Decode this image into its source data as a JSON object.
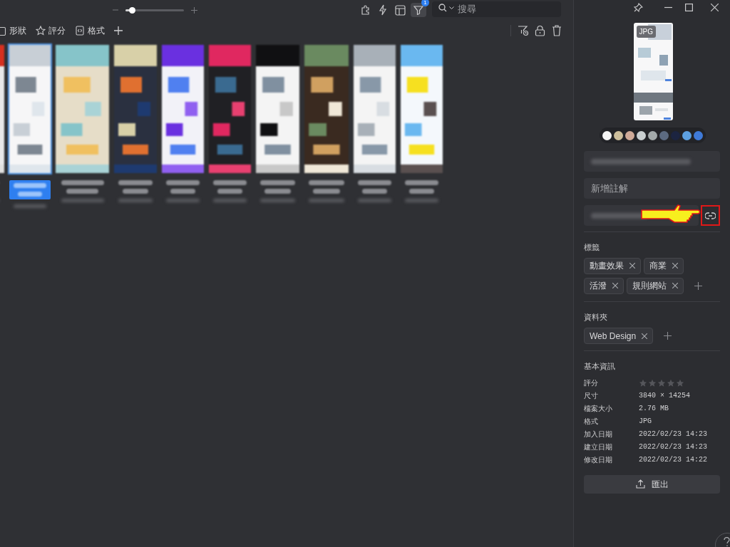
{
  "toolbar": {
    "zoom": {
      "level": 0.12
    },
    "filter_badge": "1",
    "search": {
      "placeholder": "搜尋"
    }
  },
  "filters": [
    "形狀",
    "評分",
    "格式"
  ],
  "thumbnails": [
    {
      "kind": "picture",
      "selected": false
    },
    {
      "kind": "picture",
      "selected": true
    },
    {
      "kind": "picture",
      "selected": false
    },
    {
      "kind": "picture",
      "selected": false
    },
    {
      "kind": "picture",
      "selected": false
    },
    {
      "kind": "picture",
      "selected": false
    },
    {
      "kind": "picture",
      "selected": false
    },
    {
      "kind": "picture",
      "selected": false
    },
    {
      "kind": "picture",
      "selected": false
    },
    {
      "kind": "picture",
      "selected": false
    }
  ],
  "inspector": {
    "preview": {
      "badge": "JPG"
    },
    "palette": [
      {
        "color": "#f4f4f4"
      },
      {
        "color": "#cdbf9c"
      },
      {
        "color": "#cfaa98"
      },
      {
        "color": "#c9cfd0"
      },
      {
        "color": "#a3a9aa"
      },
      {
        "color": "#5c6a80"
      },
      {
        "color": "#1c2440"
      },
      {
        "color": "#5da0e0"
      },
      {
        "color": "#3f7ad8"
      }
    ],
    "note": {
      "placeholder": "新增註解"
    },
    "tags": {
      "title": "標籤",
      "items": [
        "動畫效果",
        "商業",
        "活潑",
        "規則網站"
      ]
    },
    "folders": {
      "title": "資料夾",
      "items": [
        "Web Design"
      ]
    },
    "info": {
      "title": "基本資訊",
      "rating": {
        "label": "評分",
        "stars": 0
      },
      "rows": [
        {
          "label": "尺寸",
          "value": "3840 × 14254"
        },
        {
          "label": "檔案大小",
          "value": "2.76 MB"
        },
        {
          "label": "格式",
          "value": "JPG"
        },
        {
          "label": "加入日期",
          "value": "2022/02/23 14:23"
        },
        {
          "label": "建立日期",
          "value": "2022/02/23 14:23"
        },
        {
          "label": "修改日期",
          "value": "2022/02/23 14:22"
        }
      ]
    },
    "export_button": "匯出"
  }
}
